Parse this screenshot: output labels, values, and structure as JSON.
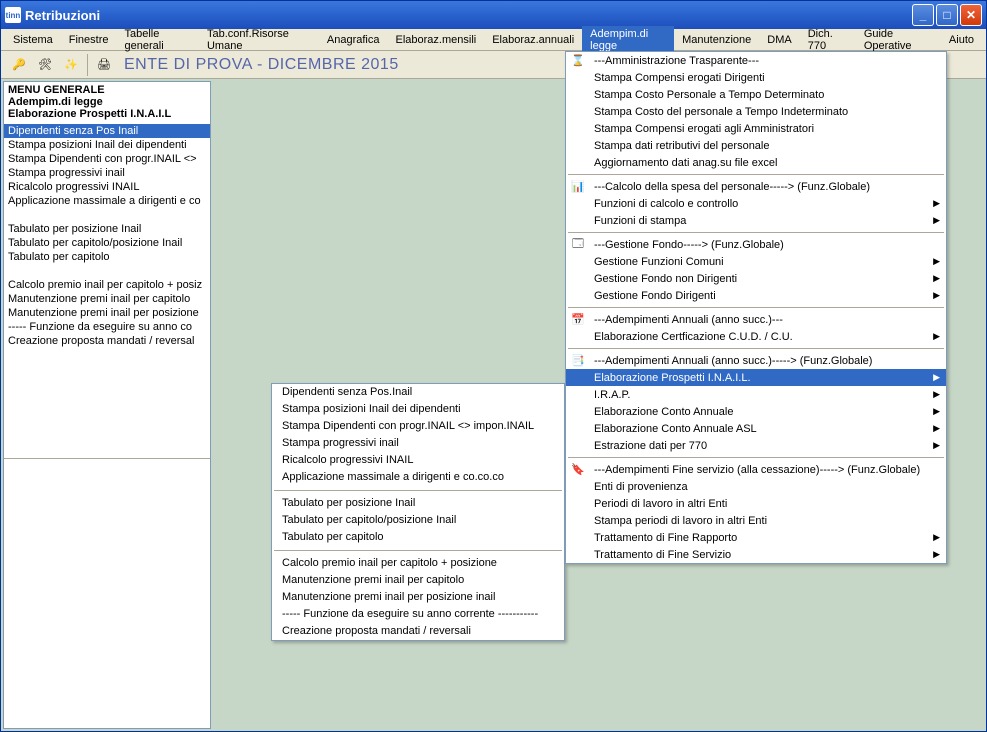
{
  "window": {
    "title": "Retribuzioni",
    "icon_text": "tinn"
  },
  "menubar": [
    "Sistema",
    "Finestre",
    "Tabelle generali",
    "Tab.conf.Risorse Umane",
    "Anagrafica",
    "Elaboraz.mensili",
    "Elaboraz.annuali",
    "Adempim.di legge",
    "Manutenzione",
    "DMA",
    "Dich. 770",
    "Guide Operative",
    "Aiuto"
  ],
  "menubar_active_index": 7,
  "context_label": "ENTE DI PROVA - DICEMBRE 2015",
  "sidebar": {
    "header": [
      "MENU GENERALE",
      "Adempim.di legge",
      " Elaborazione Prospetti I.N.A.I.L"
    ],
    "items": [
      {
        "label": "Dipendenti senza Pos Inail",
        "selected": true
      },
      {
        "label": "Stampa posizioni Inail dei dipendenti"
      },
      {
        "label": "Stampa Dipendenti con progr.INAIL <>"
      },
      {
        "label": "Stampa progressivi inail"
      },
      {
        "label": "Ricalcolo progressivi INAIL"
      },
      {
        "label": "Applicazione massimale a dirigenti e co"
      },
      {
        "label": ""
      },
      {
        "label": "Tabulato per posizione Inail"
      },
      {
        "label": "Tabulato per capitolo/posizione Inail"
      },
      {
        "label": "Tabulato per capitolo"
      },
      {
        "label": ""
      },
      {
        "label": "Calcolo premio inail per capitolo + posiz"
      },
      {
        "label": "Manutenzione premi inail per capitolo"
      },
      {
        "label": "Manutenzione premi inail per posizione"
      },
      {
        "label": "----- Funzione da eseguire su anno co"
      },
      {
        "label": "Creazione proposta mandati / reversal"
      }
    ]
  },
  "dropdown": {
    "groups": [
      {
        "icon": "⌛",
        "header": "---Amministrazione Trasparente---",
        "items": [
          {
            "label": "Stampa Compensi erogati Dirigenti"
          },
          {
            "label": "Stampa Costo Personale a Tempo Determinato"
          },
          {
            "label": "Stampa Costo del personale a Tempo Indeterminato"
          },
          {
            "label": "Stampa Compensi erogati agli Amministratori"
          },
          {
            "label": "Stampa dati retributivi del personale"
          },
          {
            "label": "Aggiornamento dati anag.su file excel"
          }
        ]
      },
      {
        "icon": "📊",
        "header": "---Calcolo della spesa del personale-----> (Funz.Globale)",
        "items": [
          {
            "label": "Funzioni di calcolo e controllo",
            "arrow": true
          },
          {
            "label": "Funzioni di stampa",
            "arrow": true
          }
        ]
      },
      {
        "icon": "🗔",
        "header": "---Gestione Fondo-----> (Funz.Globale)",
        "items": [
          {
            "label": "Gestione Funzioni Comuni",
            "arrow": true
          },
          {
            "label": "Gestione Fondo non Dirigenti",
            "arrow": true
          },
          {
            "label": "Gestione Fondo Dirigenti",
            "arrow": true
          }
        ]
      },
      {
        "icon": "📅",
        "header": "---Adempimenti Annuali (anno succ.)---",
        "items": [
          {
            "label": "Elaborazione Certficazione C.U.D. / C.U.",
            "arrow": true
          }
        ]
      },
      {
        "icon": "📑",
        "header": "---Adempimenti Annuali (anno succ.)-----> (Funz.Globale)",
        "items": [
          {
            "label": "Elaborazione Prospetti I.N.A.I.L.",
            "arrow": true,
            "highlight": true
          },
          {
            "label": "I.R.A.P.",
            "arrow": true
          },
          {
            "label": "Elaborazione Conto Annuale",
            "arrow": true
          },
          {
            "label": "Elaborazione Conto Annuale ASL",
            "arrow": true
          },
          {
            "label": "Estrazione dati per 770",
            "arrow": true
          }
        ]
      },
      {
        "icon": "🔖",
        "header": "---Adempimenti Fine servizio (alla cessazione)-----> (Funz.Globale)",
        "items": [
          {
            "label": "Enti di provenienza"
          },
          {
            "label": "Periodi di lavoro in altri Enti"
          },
          {
            "label": "Stampa periodi di lavoro in altri Enti"
          },
          {
            "label": "Trattamento di Fine Rapporto",
            "arrow": true
          },
          {
            "label": "Trattamento di Fine Servizio",
            "arrow": true
          }
        ]
      }
    ]
  },
  "submenu": {
    "groups": [
      [
        "Dipendenti senza Pos.Inail",
        "Stampa posizioni Inail dei dipendenti",
        "Stampa Dipendenti con progr.INAIL <> impon.INAIL",
        "Stampa progressivi inail",
        "Ricalcolo progressivi INAIL",
        "Applicazione massimale a dirigenti e co.co.co"
      ],
      [
        "Tabulato per posizione Inail",
        "Tabulato per capitolo/posizione Inail",
        "Tabulato per capitolo"
      ],
      [
        "Calcolo premio inail per capitolo + posizione",
        "Manutenzione premi inail per capitolo",
        "Manutenzione premi inail per posizione inail",
        "----- Funzione da eseguire su anno corrente -----------",
        "Creazione proposta mandati / reversali"
      ]
    ]
  },
  "toolbar_icons": [
    "key-icon",
    "tool-icon",
    "wand-icon",
    "print-icon"
  ]
}
